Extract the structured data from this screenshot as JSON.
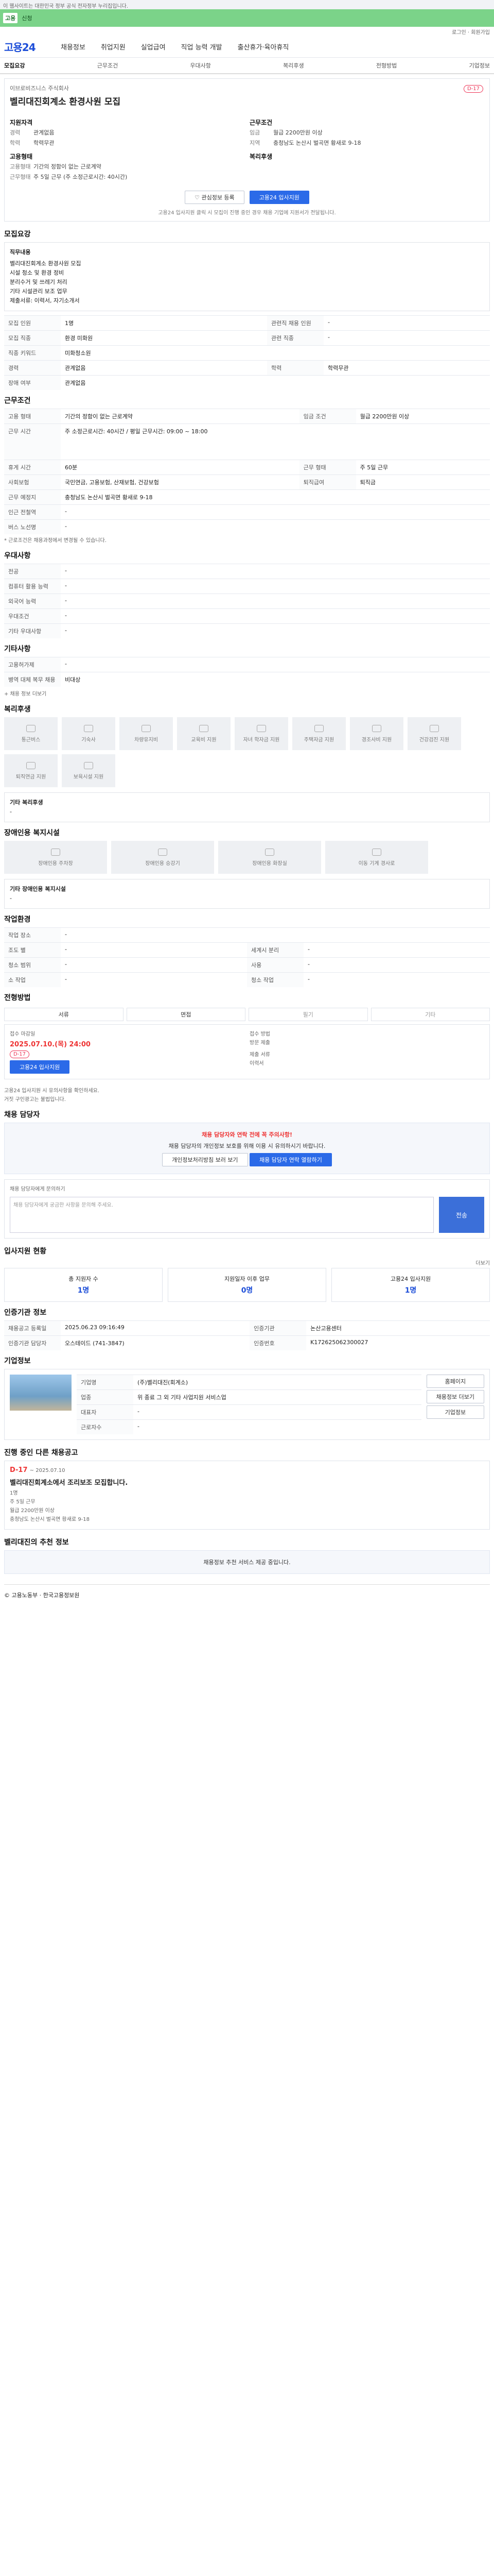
{
  "top_notice": "이 웹사이트는 대한민국 정부 공식 전자정부 누리집입니다.",
  "green_bar": {
    "logo": "고용",
    "tag": "신청"
  },
  "util": "로그인 · 회원가입",
  "brand": "고용24",
  "nav": [
    "채용정보",
    "취업지원",
    "실업급여",
    "직업 능력 개발",
    "출산휴가·육아휴직"
  ],
  "tabs": [
    "모집요강",
    "근무조건",
    "우대사항",
    "복리후생",
    "전형방법",
    "기업정보"
  ],
  "header": {
    "company": "이브로비즈니스 주식회사",
    "title": "벨리대진회계소 환경사원 모집",
    "dday": "D-17",
    "left_title": "지원자격",
    "right_title": "근무조건",
    "left_rows": [
      [
        "경력",
        "관계없음"
      ],
      [
        "학력",
        "학력무관"
      ]
    ],
    "right_rows": [
      [
        "임금",
        "월급 2200만원 이상"
      ],
      [
        "지역",
        "충청남도 논산시 벌곡면 황새로 9-18"
      ]
    ],
    "left_title2": "고용형태",
    "right_title2": "복리후생",
    "left_rows2": [
      [
        "고용형태",
        "기간의 정함이 없는 근로계약"
      ],
      [
        "근무형태",
        "주 5일 근무 (주 소정근로시간: 40시간)"
      ]
    ],
    "btn_scrap": "관심정보 등록",
    "btn_apply": "고용24 입사지원",
    "note": "고용24 입사지원 클릭 시 모집이 진행 중인 경우 채용 기업에 지원서가 전달됩니다."
  },
  "sections": {
    "recruit": "모집요강",
    "job_desc_title": "직무내용",
    "job_desc": [
      "벨리대진회계소 환경사원 모집",
      "시설 청소 및 환경 정비",
      "분리수거 및 쓰레기 처리",
      "기타 시설관리 보조 업무",
      "제출서류: 이력서, 자기소개서"
    ],
    "recruit_rows": [
      [
        "모집 인원",
        "1명",
        "관련직 채용 인원",
        "-"
      ],
      [
        "모집 직종",
        "환경 미화원",
        "관련 직종",
        "-"
      ],
      [
        "직종 키워드",
        "미화청소원",
        "",
        ""
      ],
      [
        "경력",
        "관계없음",
        "학력",
        "학력무관"
      ],
      [
        "장애 여부",
        "관계없음",
        "",
        ""
      ]
    ],
    "work": "근무조건",
    "work_rows": [
      [
        "고용 형태",
        "기간의 정함이 없는 근로계약",
        "임금 조건",
        "월급 2200만원 이상"
      ],
      [
        "근무 시간",
        "주 소정근로시간: 40시간 / 평일 근무시간: 09:00 ~ 18:00",
        "",
        ""
      ],
      [
        "휴게 시간",
        "60분",
        "근무 형태",
        "주 5일 근무"
      ],
      [
        "사회보험",
        "국민연금, 고용보험, 산재보험, 건강보험",
        "퇴직급여",
        "퇴직금"
      ],
      [
        "근무 예정지",
        "충청남도 논산시 벌곡면 황새로 9-18",
        "",
        ""
      ],
      [
        "인근 전철역",
        "-",
        "",
        ""
      ],
      [
        "버스 노선명",
        "-",
        "",
        ""
      ]
    ],
    "work_note": "* 근로조건은 채용과정에서 변경될 수 있습니다.",
    "pref": "우대사항",
    "pref_rows": [
      [
        "전공",
        "-"
      ],
      [
        "컴퓨터 활용 능력",
        "-"
      ],
      [
        "외국어 능력",
        "-"
      ],
      [
        "우대조건",
        "-"
      ],
      [
        "기타 우대사항",
        "-"
      ]
    ],
    "etc": "기타사항",
    "etc_rows": [
      [
        "고용허가제",
        "-"
      ],
      [
        "병역 대체 복무 채용",
        "비대상"
      ]
    ],
    "more_link": "+ 채용 정보 더보기",
    "welfare": "복리후생",
    "welfare_items": [
      "통근버스",
      "기숙사",
      "차량유지비",
      "교육비 지원",
      "자녀 학자금 지원",
      "주택자금 지원",
      "경조사비 지원",
      "건강검진 지원",
      "퇴직연금 지원",
      "보육시설 지원"
    ],
    "welfare_extra_title": "기타 복리후생",
    "welfare_extra": "-",
    "disability": "장애인용 복지시설",
    "disability_items": [
      "장애인용 주차장",
      "장애인용 승강기",
      "장애인용 화장실",
      "이동 기계 경사로"
    ],
    "disability_extra_title": "기타 장애인용 복지시설",
    "disability_extra": "-",
    "env": "작업환경",
    "env_rows": [
      [
        "작업 장소",
        "-",
        "",
        ""
      ],
      [
        "조도 별",
        "-",
        "세계시 분리",
        "-"
      ],
      [
        "청소 범위",
        "-",
        "사용",
        "-"
      ],
      [
        "소 작업",
        "-",
        "청소 작업",
        "-"
      ]
    ],
    "process": "전형방법",
    "steps": [
      "서류",
      "면접",
      "필기",
      "기타"
    ],
    "deadline_title": "접수 마감일",
    "deadline": "2025.07.10.(목) 24:00",
    "dday": "D-17",
    "apply_method_title": "접수 방법",
    "apply_method": "방문 제출",
    "docs_title": "제출 서류",
    "docs": "이력서",
    "apply_btn": "고용24 입사지원",
    "notes": [
      "고용24 입사지원 시 유의사항을 확인하세요.",
      "거짓 구인광고는 불법입니다."
    ],
    "contact": "채용 담당자",
    "contact_warn": "채용 담당자와 연락 전에 꼭 주의사항!",
    "contact_desc": "채용 담당자의 개인정보 보호를 위해 이용 시 유의하시기 바랍니다.",
    "contact_btn1": "개인정보처리방침 보러 보기",
    "contact_btn2": "채용 담당자 연락 열람하기",
    "qa_title": "채용 담당자에게 문의하기",
    "qa_placeholder": "채용 담당자에게 궁금한 사항을 문의해 주세요.",
    "qa_btn": "전송",
    "applicant": "입사지원 현황",
    "applicant_items": [
      [
        "총 지원자 수",
        "1명"
      ],
      [
        "지원일자 이후 업무",
        "0명"
      ],
      [
        "고용24 입사지원",
        "1명"
      ]
    ],
    "applicant_more": "더보기",
    "cert": "인증기관 정보",
    "cert_rows": [
      [
        "채용공고 등록일",
        "2025.06.23 09:16:49",
        "인증기관",
        "논산고용센터"
      ],
      [
        "인증기관 담당자",
        "오스테이드 (741-3847)",
        "인증번호",
        "K172625062300027"
      ]
    ],
    "company": "기업정보",
    "company_rows": [
      [
        "기업명",
        "(주)벨리대진(회계소)"
      ],
      [
        "업종",
        "위 종료 그 외 기타 사업지원 서비스업"
      ],
      [
        "대표자",
        "-"
      ],
      [
        "근로자수",
        "-"
      ]
    ],
    "company_btns": [
      "홈페이지",
      "채용정보 더보기",
      "기업정보"
    ],
    "other": "진행 중인 다른 채용공고",
    "other_dday": "D-17",
    "other_period": "~ 2025.07.10",
    "other_title": "벨리대진회계소에서 조리보조 모집합니다.",
    "other_meta": [
      "1명",
      "주 5일 근무",
      "월급 2200만원 이상",
      "충청남도 논산시 벌곡면 황새로 9-18"
    ],
    "reco": "벨리대진의 추천 정보",
    "reco_text": "채용정보 추천 서비스 제공 중입니다.",
    "footer": "© 고용노동부 · 한국고용정보원"
  }
}
